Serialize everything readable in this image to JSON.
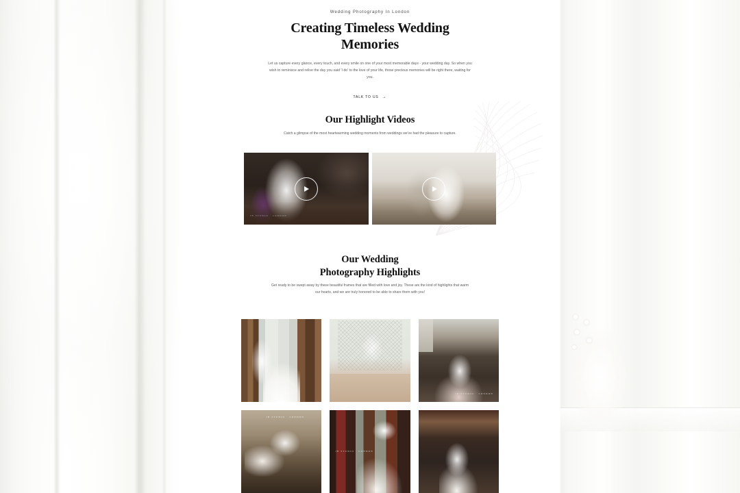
{
  "hero": {
    "eyebrow": "Wedding Photography In London",
    "title": "Creating Timeless Wedding Memories",
    "copy": "Let us capture every glance, every touch, and every smile on one of your most memorable days - your wedding day. So when you wish to reminisce and relive the day you said 'I do' to the love of your life, those precious memories will be right there, waiting for you.",
    "cta_label": "TALK TO US",
    "cta_arrow": "→"
  },
  "videos_section": {
    "title": "Our Highlight Videos",
    "copy": "Catch a glimpse of the most heartwarming wedding moments from weddings we've had the pleasure to capture.",
    "items": [
      {
        "alt": "First dance in candlelit manor ballroom",
        "watermark": "JB STUDIO · LONDON",
        "play_icon": "play-icon"
      },
      {
        "alt": "Bride and groom walking down the church aisle",
        "watermark": "",
        "play_icon": "play-icon"
      }
    ]
  },
  "highlights_section": {
    "title_line1": "Our Wedding",
    "title_line2": "Photography Highlights",
    "copy": "Get ready to be swept away by these beautiful frames that are filled with love and joy. These are the kind of highlights that warm our hearts, and we are truly honored to be able to share them with you!",
    "tiles": [
      {
        "alt": "Bride in lace gown by tall window with brown drapes",
        "watermark": ""
      },
      {
        "alt": "Wedding party at the top table beneath gothic windows",
        "watermark": ""
      },
      {
        "alt": "Group portrait of family and bridal party under a chandelier",
        "watermark": "JB STUDIO · LONDON"
      },
      {
        "alt": "Bride signing the register with the vicar",
        "watermark": "JB STUDIO · LONDON"
      },
      {
        "alt": "Bride by the window in a red drawing room",
        "watermark": "JB STUDIO · LONDON"
      },
      {
        "alt": "Bride and groom walking back down the aisle past guests",
        "watermark": ""
      }
    ]
  },
  "colors": {
    "page_background": "#ffffff",
    "backdrop": "#f7f7f5",
    "heading": "#101010",
    "body_text": "#5b5b5b"
  }
}
